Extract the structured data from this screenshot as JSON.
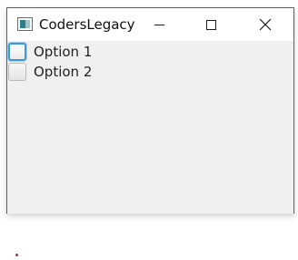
{
  "window": {
    "title": "CodersLegacy",
    "controls": {
      "minimize_icon": "minimize-icon",
      "maximize_icon": "maximize-icon",
      "close_icon": "close-icon",
      "close_glyph": "✕"
    }
  },
  "checkboxes": [
    {
      "label": "Option 1",
      "checked": false,
      "focused": true
    },
    {
      "label": "Option 2",
      "checked": false,
      "focused": false
    }
  ],
  "colors": {
    "focus_ring": "#3a9ad9",
    "window_background": "#f0f0f0",
    "titlebar_background": "#ffffff",
    "stray_dot": "#b0343a"
  }
}
